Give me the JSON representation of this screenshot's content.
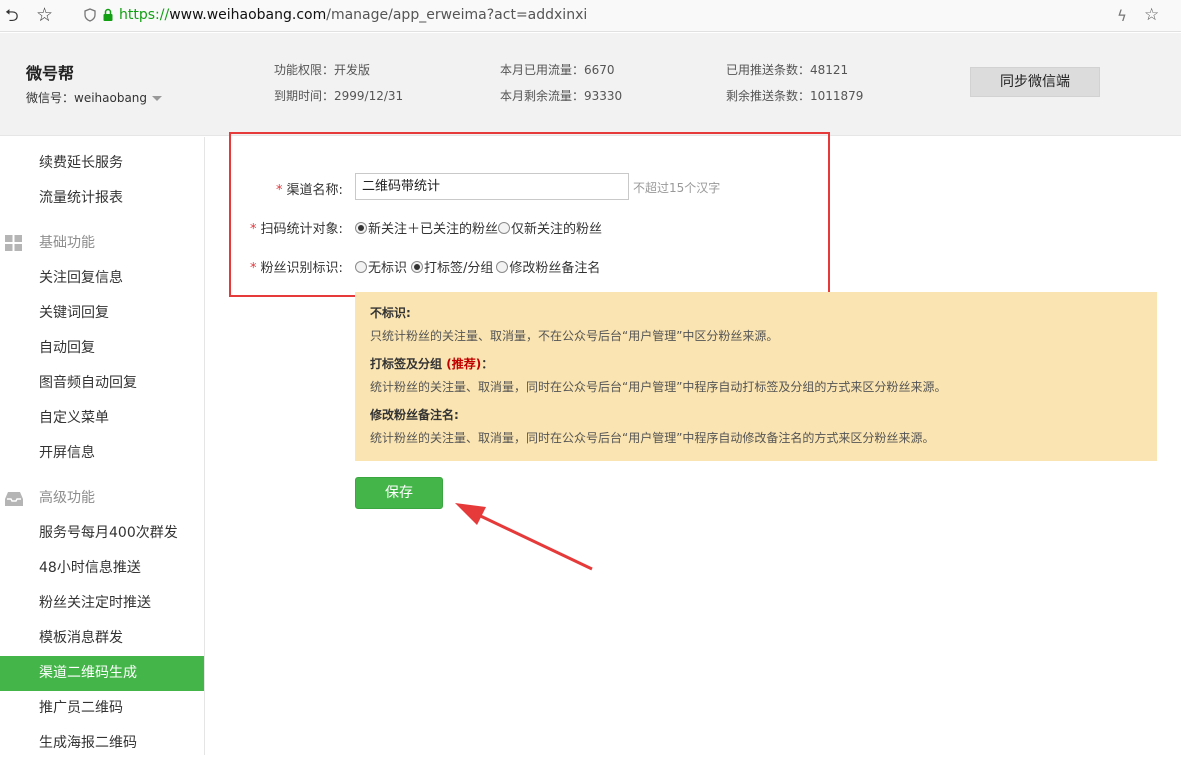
{
  "browser": {
    "url_proto": "https://",
    "url_host": "www.weihaobang.com",
    "url_path": "/manage/app_erweima?act=addxinxi"
  },
  "header": {
    "account_name": "微号帮",
    "wechat_id_label": "微信号：weihaobang",
    "stats": {
      "permission": "功能权限：开发版",
      "expire": "到期时间：2999/12/31",
      "used_traffic": "本月已用流量：6670",
      "remaining_traffic": "本月剩余流量：93330",
      "used_push": "已用推送条数：48121",
      "remaining_push": "剩余推送条数：1011879"
    },
    "sync_button": "同步微信端"
  },
  "sidebar": {
    "items_top": [
      "续费延长服务",
      "流量统计报表"
    ],
    "section_basic": "基础功能",
    "items_basic": [
      "关注回复信息",
      "关键词回复",
      "自动回复",
      "图音频自动回复",
      "自定义菜单",
      "开屏信息"
    ],
    "section_advanced": "高级功能",
    "items_advanced": [
      "服务号每月400次群发",
      "48小时信息推送",
      "粉丝关注定时推送",
      "模板消息群发",
      "渠道二维码生成",
      "推广员二维码",
      "生成海报二维码"
    ],
    "active_item": "渠道二维码生成"
  },
  "form": {
    "required_mark": "*",
    "channel_name_label": "渠道名称:",
    "channel_name_value": "二维码带统计",
    "channel_name_hint": "不超过15个汉字",
    "scan_target_label": "扫码统计对象:",
    "scan_target_options": [
      "新关注＋已关注的粉丝",
      "仅新关注的粉丝"
    ],
    "scan_target_selected": 0,
    "fan_mark_label": "粉丝识别标识:",
    "fan_mark_options": [
      "无标识",
      "打标签/分组",
      "修改粉丝备注名"
    ],
    "fan_mark_selected": 1
  },
  "info": {
    "t1": "不标识:",
    "d1": "只统计粉丝的关注量、取消量，不在公众号后台“用户管理”中区分粉丝来源。",
    "t2": "打标签及分组",
    "t2_rec": "(推荐)",
    "t2_colon": "：",
    "d2": "统计粉丝的关注量、取消量，同时在公众号后台“用户管理”中程序自动打标签及分组的方式来区分粉丝来源。",
    "t3": "修改粉丝备注名:",
    "d3": "统计粉丝的关注量、取消量，同时在公众号后台“用户管理”中程序自动修改备注名的方式来区分粉丝来源。"
  },
  "save_button": "保存",
  "colors": {
    "accent_green": "#44b549",
    "highlight_red": "#e63a3a",
    "info_bg": "#fae4b1"
  }
}
